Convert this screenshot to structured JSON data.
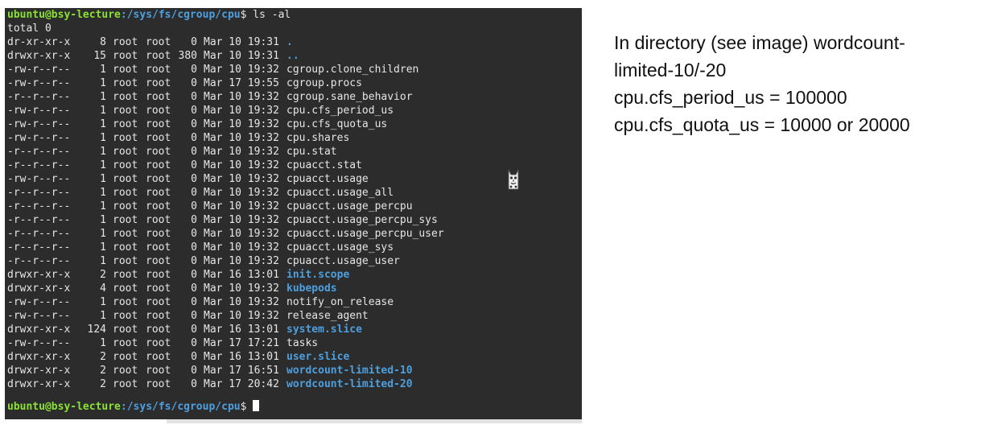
{
  "terminal": {
    "prompt_user_host": "ubuntu@bsy-lecture",
    "prompt_path": ":/sys/fs/cgroup/cpu",
    "prompt_symbol": "$",
    "command": " ls -al",
    "total_line": "total 0",
    "entries": [
      {
        "perm": "dr-xr-xr-x",
        "links": "8",
        "owner": "root",
        "group": "root",
        "size": "0",
        "date": "Mar 10 19:31",
        "name": ".",
        "is_dir": true
      },
      {
        "perm": "drwxr-xr-x",
        "links": "15",
        "owner": "root",
        "group": "root",
        "size": "380",
        "date": "Mar 10 19:31",
        "name": "..",
        "is_dir": true
      },
      {
        "perm": "-rw-r--r--",
        "links": "1",
        "owner": "root",
        "group": "root",
        "size": "0",
        "date": "Mar 10 19:32",
        "name": "cgroup.clone_children",
        "is_dir": false
      },
      {
        "perm": "-rw-r--r--",
        "links": "1",
        "owner": "root",
        "group": "root",
        "size": "0",
        "date": "Mar 17 19:55",
        "name": "cgroup.procs",
        "is_dir": false
      },
      {
        "perm": "-r--r--r--",
        "links": "1",
        "owner": "root",
        "group": "root",
        "size": "0",
        "date": "Mar 10 19:32",
        "name": "cgroup.sane_behavior",
        "is_dir": false
      },
      {
        "perm": "-rw-r--r--",
        "links": "1",
        "owner": "root",
        "group": "root",
        "size": "0",
        "date": "Mar 10 19:32",
        "name": "cpu.cfs_period_us",
        "is_dir": false
      },
      {
        "perm": "-rw-r--r--",
        "links": "1",
        "owner": "root",
        "group": "root",
        "size": "0",
        "date": "Mar 10 19:32",
        "name": "cpu.cfs_quota_us",
        "is_dir": false
      },
      {
        "perm": "-rw-r--r--",
        "links": "1",
        "owner": "root",
        "group": "root",
        "size": "0",
        "date": "Mar 10 19:32",
        "name": "cpu.shares",
        "is_dir": false
      },
      {
        "perm": "-r--r--r--",
        "links": "1",
        "owner": "root",
        "group": "root",
        "size": "0",
        "date": "Mar 10 19:32",
        "name": "cpu.stat",
        "is_dir": false
      },
      {
        "perm": "-r--r--r--",
        "links": "1",
        "owner": "root",
        "group": "root",
        "size": "0",
        "date": "Mar 10 19:32",
        "name": "cpuacct.stat",
        "is_dir": false
      },
      {
        "perm": "-rw-r--r--",
        "links": "1",
        "owner": "root",
        "group": "root",
        "size": "0",
        "date": "Mar 10 19:32",
        "name": "cpuacct.usage",
        "is_dir": false
      },
      {
        "perm": "-r--r--r--",
        "links": "1",
        "owner": "root",
        "group": "root",
        "size": "0",
        "date": "Mar 10 19:32",
        "name": "cpuacct.usage_all",
        "is_dir": false
      },
      {
        "perm": "-r--r--r--",
        "links": "1",
        "owner": "root",
        "group": "root",
        "size": "0",
        "date": "Mar 10 19:32",
        "name": "cpuacct.usage_percpu",
        "is_dir": false
      },
      {
        "perm": "-r--r--r--",
        "links": "1",
        "owner": "root",
        "group": "root",
        "size": "0",
        "date": "Mar 10 19:32",
        "name": "cpuacct.usage_percpu_sys",
        "is_dir": false
      },
      {
        "perm": "-r--r--r--",
        "links": "1",
        "owner": "root",
        "group": "root",
        "size": "0",
        "date": "Mar 10 19:32",
        "name": "cpuacct.usage_percpu_user",
        "is_dir": false
      },
      {
        "perm": "-r--r--r--",
        "links": "1",
        "owner": "root",
        "group": "root",
        "size": "0",
        "date": "Mar 10 19:32",
        "name": "cpuacct.usage_sys",
        "is_dir": false
      },
      {
        "perm": "-r--r--r--",
        "links": "1",
        "owner": "root",
        "group": "root",
        "size": "0",
        "date": "Mar 10 19:32",
        "name": "cpuacct.usage_user",
        "is_dir": false
      },
      {
        "perm": "drwxr-xr-x",
        "links": "2",
        "owner": "root",
        "group": "root",
        "size": "0",
        "date": "Mar 16 13:01",
        "name": "init.scope",
        "is_dir": true
      },
      {
        "perm": "drwxr-xr-x",
        "links": "4",
        "owner": "root",
        "group": "root",
        "size": "0",
        "date": "Mar 10 19:32",
        "name": "kubepods",
        "is_dir": true
      },
      {
        "perm": "-rw-r--r--",
        "links": "1",
        "owner": "root",
        "group": "root",
        "size": "0",
        "date": "Mar 10 19:32",
        "name": "notify_on_release",
        "is_dir": false
      },
      {
        "perm": "-rw-r--r--",
        "links": "1",
        "owner": "root",
        "group": "root",
        "size": "0",
        "date": "Mar 10 19:32",
        "name": "release_agent",
        "is_dir": false
      },
      {
        "perm": "drwxr-xr-x",
        "links": "124",
        "owner": "root",
        "group": "root",
        "size": "0",
        "date": "Mar 16 13:01",
        "name": "system.slice",
        "is_dir": true
      },
      {
        "perm": "-rw-r--r--",
        "links": "1",
        "owner": "root",
        "group": "root",
        "size": "0",
        "date": "Mar 17 17:21",
        "name": "tasks",
        "is_dir": false
      },
      {
        "perm": "drwxr-xr-x",
        "links": "2",
        "owner": "root",
        "group": "root",
        "size": "0",
        "date": "Mar 16 13:01",
        "name": "user.slice",
        "is_dir": true
      },
      {
        "perm": "drwxr-xr-x",
        "links": "2",
        "owner": "root",
        "group": "root",
        "size": "0",
        "date": "Mar 17 16:51",
        "name": "wordcount-limited-10",
        "is_dir": true
      },
      {
        "perm": "drwxr-xr-x",
        "links": "2",
        "owner": "root",
        "group": "root",
        "size": "0",
        "date": "Mar 17 20:42",
        "name": "wordcount-limited-20",
        "is_dir": true
      }
    ],
    "colors": {
      "background": "#2c2c2c",
      "text": "#e6e6e6",
      "prompt_user": "#8ae234",
      "prompt_path": "#4e9fde",
      "directory": "#4e9fde"
    }
  },
  "cat_icon": "cat-face-icon",
  "notes": {
    "line1": "In directory (see image) wordcount-",
    "line2": "limited-10/-20",
    "line3": "cpu.cfs_period_us = 100000",
    "line4": "cpu.cfs_quota_us = 10000 or 20000"
  }
}
